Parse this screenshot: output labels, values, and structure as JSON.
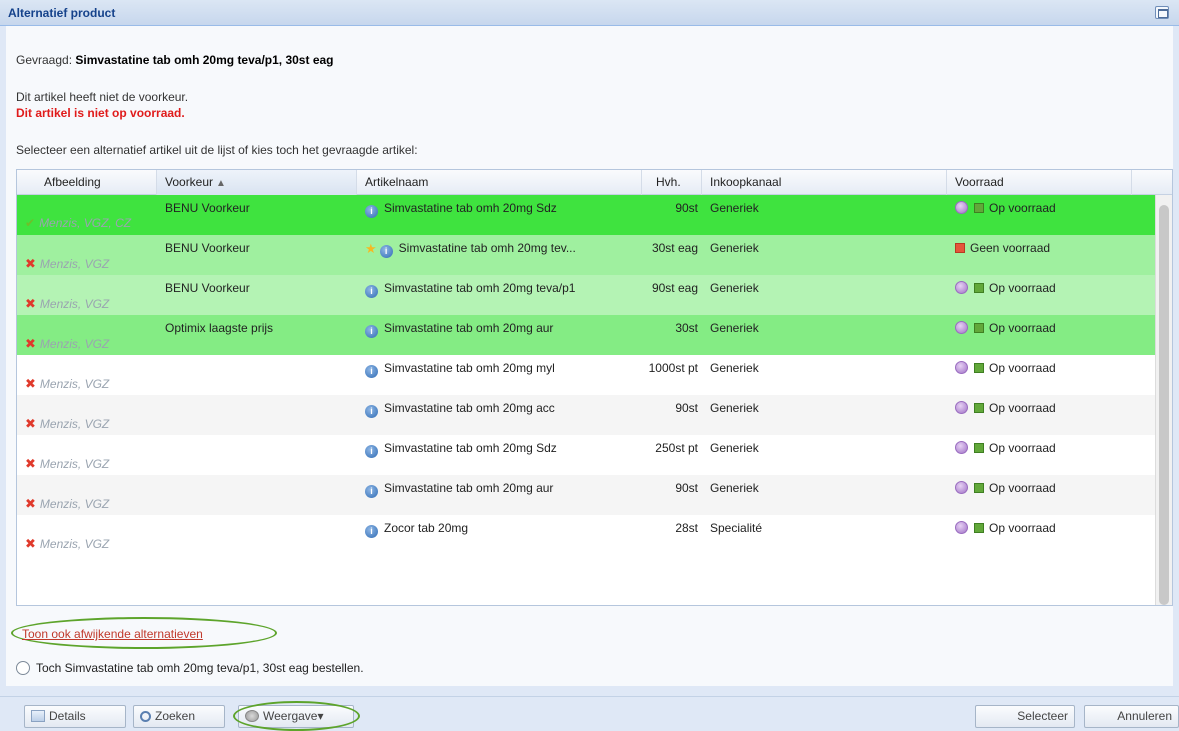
{
  "window": {
    "title": "Alternatief product"
  },
  "request": {
    "label": "Gevraagd:",
    "product": "Simvastatine tab omh 20mg teva/p1, 30st eag"
  },
  "messages": {
    "not_preferred": "Dit artikel heeft niet de voorkeur.",
    "not_in_stock": "Dit artikel is niet op voorraad.",
    "instruction": "Selecteer een alternatief artikel uit de lijst of kies toch het gevraagde artikel:"
  },
  "grid": {
    "columns": {
      "image": "Afbeelding",
      "preference": "Voorkeur",
      "preference_sort": "▲",
      "name": "Artikelnaam",
      "qty": "Hvh.",
      "channel": "Inkoopkanaal",
      "stock": "Voorraad"
    },
    "rows": [
      {
        "insurers": "Menzis, VGZ, CZ",
        "ok": true,
        "preference": "BENU Voorkeur",
        "name": "Simvastatine tab omh 20mg Sdz",
        "star": false,
        "qty": "90st",
        "channel": "Generiek",
        "stock": "Op voorraad",
        "in_stock": true,
        "clock": true,
        "bg": "#3fe33f"
      },
      {
        "insurers": "Menzis, VGZ",
        "ok": false,
        "preference": "BENU Voorkeur",
        "name": "Simvastatine tab omh 20mg tev...",
        "star": true,
        "qty": "30st eag",
        "channel": "Generiek",
        "stock": "Geen voorraad",
        "in_stock": false,
        "clock": false,
        "bg": "#9ff09f"
      },
      {
        "insurers": "Menzis, VGZ",
        "ok": false,
        "preference": "BENU Voorkeur",
        "name": "Simvastatine tab omh 20mg teva/p1",
        "star": false,
        "qty": "90st eag",
        "channel": "Generiek",
        "stock": "Op voorraad",
        "in_stock": true,
        "clock": true,
        "bg": "#b4f3b4"
      },
      {
        "insurers": "Menzis, VGZ",
        "ok": false,
        "preference": "Optimix laagste prijs",
        "name": "Simvastatine tab omh 20mg aur",
        "star": false,
        "qty": "30st",
        "channel": "Generiek",
        "stock": "Op voorraad",
        "in_stock": true,
        "clock": true,
        "bg": "#84ec84"
      },
      {
        "insurers": "Menzis, VGZ",
        "ok": false,
        "preference": "",
        "name": "Simvastatine tab omh 20mg myl",
        "star": false,
        "qty": "1000st pt",
        "channel": "Generiek",
        "stock": "Op voorraad",
        "in_stock": true,
        "clock": true,
        "bg": "#ffffff"
      },
      {
        "insurers": "Menzis, VGZ",
        "ok": false,
        "preference": "",
        "name": "Simvastatine tab omh 20mg acc",
        "star": false,
        "qty": "90st",
        "channel": "Generiek",
        "stock": "Op voorraad",
        "in_stock": true,
        "clock": true,
        "bg": "#f5f5f5"
      },
      {
        "insurers": "Menzis, VGZ",
        "ok": false,
        "preference": "",
        "name": "Simvastatine tab omh 20mg Sdz",
        "star": false,
        "qty": "250st pt",
        "channel": "Generiek",
        "stock": "Op voorraad",
        "in_stock": true,
        "clock": true,
        "bg": "#ffffff"
      },
      {
        "insurers": "Menzis, VGZ",
        "ok": false,
        "preference": "",
        "name": "Simvastatine tab omh 20mg aur",
        "star": false,
        "qty": "90st",
        "channel": "Generiek",
        "stock": "Op voorraad",
        "in_stock": true,
        "clock": true,
        "bg": "#f5f5f5"
      },
      {
        "insurers": "Menzis, VGZ",
        "ok": false,
        "preference": "",
        "name": "Zocor tab 20mg",
        "star": false,
        "qty": "28st",
        "channel": "Specialité",
        "stock": "Op voorraad",
        "in_stock": true,
        "clock": true,
        "bg": "#ffffff"
      }
    ]
  },
  "links": {
    "show_deviating": "Toon ook afwijkende alternatieven"
  },
  "option": {
    "order_anyway": "Toch Simvastatine tab omh 20mg teva/p1, 30st eag bestellen."
  },
  "buttons": {
    "details": "Details",
    "search": "Zoeken",
    "view": "Weergave",
    "view_caret": "▾",
    "select": "Selecteer",
    "cancel": "Annuleren"
  },
  "colors": {
    "highlight_ring": "#5da42b",
    "error_text": "#e01b1b"
  }
}
